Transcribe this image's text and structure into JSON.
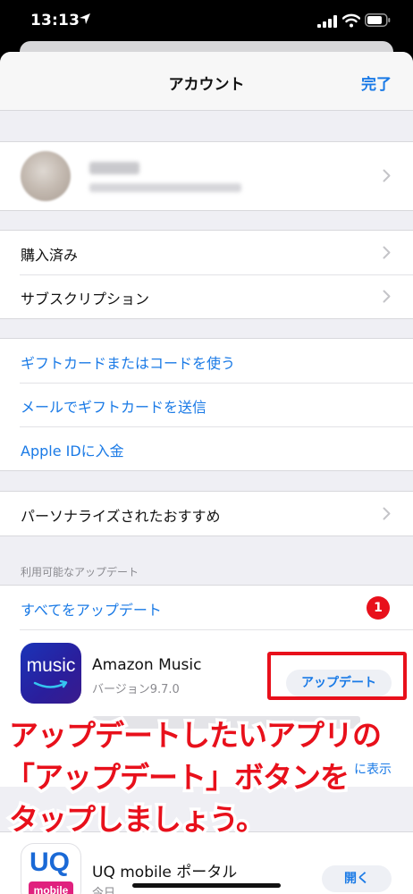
{
  "status_bar": {
    "time": "13:13"
  },
  "nav": {
    "title": "アカウント",
    "done_label": "完了"
  },
  "menu_group_1": [
    "購入済み",
    "サブスクリプション"
  ],
  "gift_group": [
    "ギフトカードまたはコードを使う",
    "メールでギフトカードを送信",
    "Apple IDに入金"
  ],
  "personalized": "パーソナライズされたおすすめ",
  "updates": {
    "section_header": "利用可能なアップデート",
    "update_all_label": "すべてをアップデート",
    "badge_count": "1"
  },
  "apps": [
    {
      "name": "Amazon Music",
      "icon_text": "music",
      "version": "バージョン9.7.0",
      "button_label": "アップデート",
      "show_more_label": "に表示"
    },
    {
      "name": "UQ mobile ポータル",
      "icon_text_top": "UQ",
      "icon_text_bottom": "mobile",
      "subtitle": "今日",
      "button_label": "開く"
    }
  ],
  "annotation": {
    "lines": [
      "アップデートしたいアプリの",
      "「アップデート」ボタンを",
      "タップしましょう。"
    ],
    "color": "#e8101b"
  },
  "colors": {
    "accent": "#1a7ae6",
    "badge": "#e8101b"
  }
}
